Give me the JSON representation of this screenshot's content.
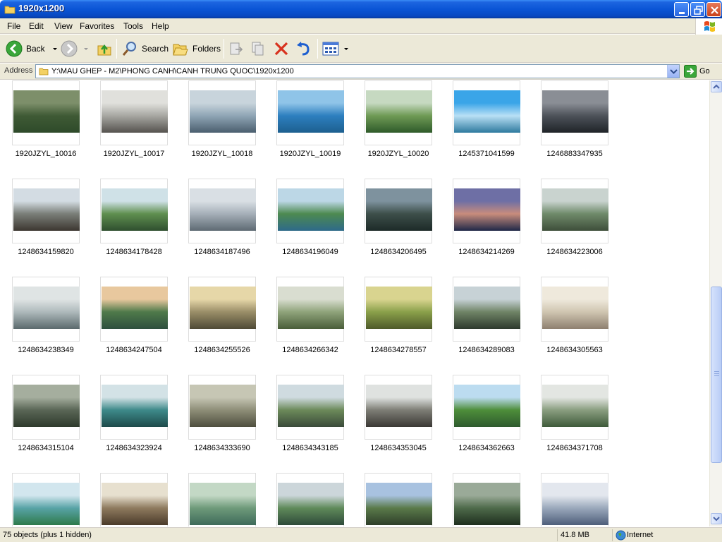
{
  "window": {
    "title": "1920x1200",
    "minimize": "minimize",
    "maximize": "restore",
    "close": "close"
  },
  "menu": [
    "File",
    "Edit",
    "View",
    "Favorites",
    "Tools",
    "Help"
  ],
  "toolbar": {
    "back": "Back",
    "search": "Search",
    "folders": "Folders"
  },
  "address": {
    "label": "Address",
    "path": "Y:\\MAU GHEP - M2\\PHONG CANH\\CANH TRUNG QUOC\\1920x1200",
    "go": "Go"
  },
  "files": [
    {
      "name": "1920JZYL_10016",
      "palette": [
        "#7d8f6a",
        "#3f5a35",
        "#2e4a2a"
      ]
    },
    {
      "name": "1920JZYL_10017",
      "palette": [
        "#e0e0dc",
        "#a7a7a2",
        "#55524e"
      ]
    },
    {
      "name": "1920JZYL_10018",
      "palette": [
        "#c8d4dc",
        "#8fa5b5",
        "#4a5e6e"
      ]
    },
    {
      "name": "1920JZYL_10019",
      "palette": [
        "#8fc4e8",
        "#2d7fbf",
        "#1d5f8f"
      ]
    },
    {
      "name": "1920JZYL_10020",
      "palette": [
        "#c6d9c1",
        "#6f9a55",
        "#2e5a2a"
      ]
    },
    {
      "name": "1245371041599",
      "palette": [
        "#3aa5e8",
        "#b9e0f5",
        "#2e7a9e"
      ]
    },
    {
      "name": "1246883347935",
      "palette": [
        "#8a8e95",
        "#4d5259",
        "#1f2328"
      ]
    },
    {
      "name": "1248634159820",
      "palette": [
        "#d3dce3",
        "#7a7e78",
        "#3c3630"
      ]
    },
    {
      "name": "1248634178428",
      "palette": [
        "#cfe1e7",
        "#5f8f4f",
        "#2f4f2f"
      ]
    },
    {
      "name": "1248634187496",
      "palette": [
        "#d9dfe4",
        "#a5afb8",
        "#5e6a73"
      ]
    },
    {
      "name": "1248634196049",
      "palette": [
        "#bcd7e6",
        "#4d8a50",
        "#2e6a8a"
      ]
    },
    {
      "name": "1248634206495",
      "palette": [
        "#7e929e",
        "#3d4f4a",
        "#1d2a28"
      ]
    },
    {
      "name": "1248634214269",
      "palette": [
        "#6e6fa5",
        "#c88c7c",
        "#1f2848"
      ]
    },
    {
      "name": "1248634223006",
      "palette": [
        "#c9d3cf",
        "#6f8a6a",
        "#3e4e3a"
      ]
    },
    {
      "name": "1248634238349",
      "palette": [
        "#dfe4e4",
        "#aeb9bb",
        "#5b6a6d"
      ]
    },
    {
      "name": "1248634247504",
      "palette": [
        "#e8c89e",
        "#4f7a4a",
        "#2e4f3e"
      ]
    },
    {
      "name": "1248634255526",
      "palette": [
        "#e6d7a8",
        "#9a8e68",
        "#4f4a36"
      ]
    },
    {
      "name": "1248634266342",
      "palette": [
        "#d9ddd0",
        "#8fa37a",
        "#4a5e3a"
      ]
    },
    {
      "name": "1248634278557",
      "palette": [
        "#d9d48f",
        "#8aa04a",
        "#4e5a2a"
      ]
    },
    {
      "name": "1248634289083",
      "palette": [
        "#c7d2d6",
        "#6f8466",
        "#2e3a2e"
      ]
    },
    {
      "name": "1248634305563",
      "palette": [
        "#efe9dc",
        "#cfc5b0",
        "#8e8070"
      ]
    },
    {
      "name": "1248634315104",
      "palette": [
        "#a5ae9e",
        "#5a6656",
        "#2e3a2c"
      ]
    },
    {
      "name": "1248634323924",
      "palette": [
        "#d3e2e6",
        "#3e8a8a",
        "#1d4a4a"
      ]
    },
    {
      "name": "1248634333690",
      "palette": [
        "#c6c6b4",
        "#8e8e78",
        "#4e4e3e"
      ]
    },
    {
      "name": "1248634343185",
      "palette": [
        "#cfdbe0",
        "#6c8a5a",
        "#3a4a3a"
      ]
    },
    {
      "name": "1248634353045",
      "palette": [
        "#dfe2e0",
        "#7e7e76",
        "#3a3834"
      ]
    },
    {
      "name": "1248634362663",
      "palette": [
        "#bcdcf0",
        "#4e8e3a",
        "#2e5a2e"
      ]
    },
    {
      "name": "1248634371708",
      "palette": [
        "#e3e6e2",
        "#8a9e80",
        "#3e5a3a"
      ]
    },
    {
      "name": "",
      "palette": [
        "#d2e6ee",
        "#58a3a6",
        "#2e7a4a"
      ]
    },
    {
      "name": "",
      "palette": [
        "#e7e0cf",
        "#8e7a5e",
        "#4a3a2a"
      ]
    },
    {
      "name": "",
      "palette": [
        "#c3d8c5",
        "#6e9a7a",
        "#3e6a5a"
      ]
    },
    {
      "name": "",
      "palette": [
        "#ccd6da",
        "#5f8a5a",
        "#2e4a3a"
      ]
    },
    {
      "name": "",
      "palette": [
        "#a8c2e0",
        "#5a7a4a",
        "#2e3e2a"
      ]
    },
    {
      "name": "",
      "palette": [
        "#9aaa98",
        "#4e6a4a",
        "#1e2e1e"
      ]
    },
    {
      "name": "",
      "palette": [
        "#e3e7ee",
        "#9aa8bb",
        "#4e5e7a"
      ]
    }
  ],
  "status": {
    "objects": "75 objects (plus 1 hidden)",
    "size": "41.8 MB",
    "zone": "Internet"
  }
}
